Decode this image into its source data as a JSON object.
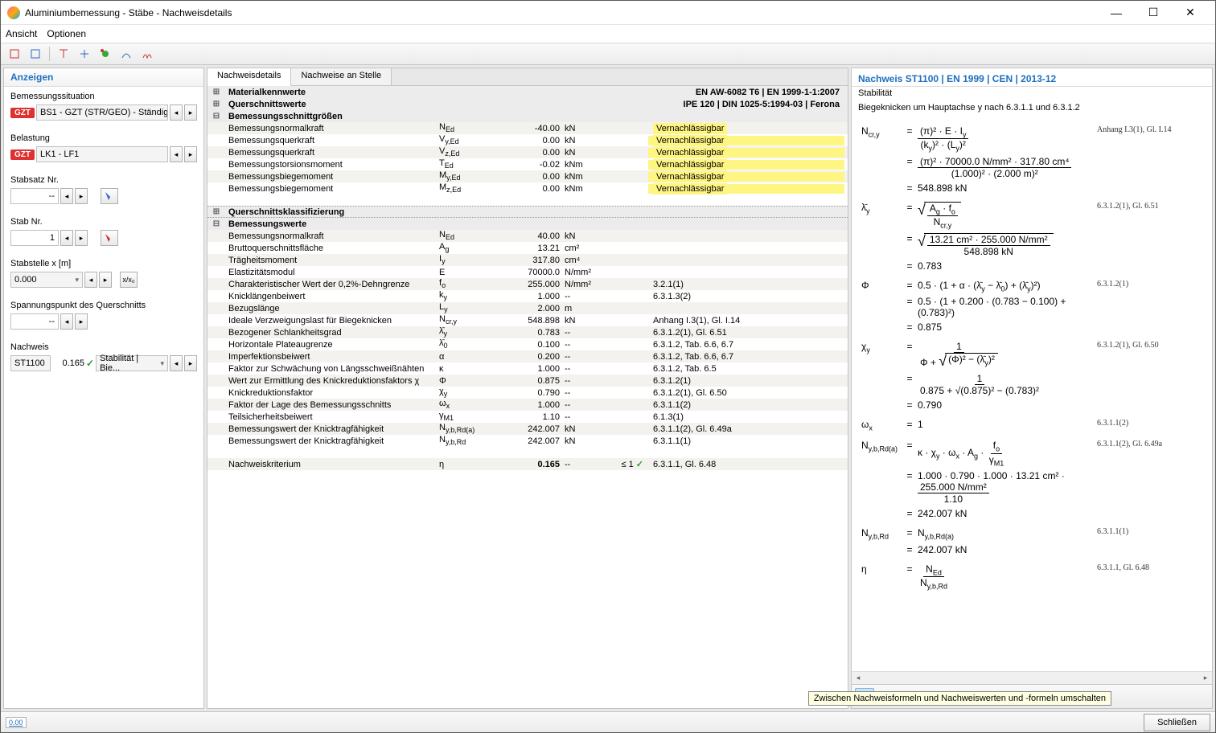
{
  "title": "Aluminiumbemessung - Stäbe - Nachweisdetails",
  "menu": {
    "m1": "Ansicht",
    "m2": "Optionen"
  },
  "left": {
    "header": "Anzeigen",
    "ds_label": "Bemessungssituation",
    "ds_badge": "GZT",
    "ds_value": "BS1 - GZT (STR/GEO) - Ständig ...",
    "load_label": "Belastung",
    "load_badge": "GZT",
    "load_value": "LK1 - LF1",
    "memberset_label": "Stabsatz Nr.",
    "memberset_value": "--",
    "member_label": "Stab Nr.",
    "member_value": "1",
    "x_label": "Stabstelle x [m]",
    "x_value": "0.000",
    "stress_label": "Spannungspunkt des Querschnitts",
    "stress_value": "--",
    "check_label": "Nachweis",
    "check_id": "ST1100",
    "check_ratio": "0.165",
    "check_name": "Stabilität | Bie..."
  },
  "tabs": {
    "t1": "Nachweisdetails",
    "t2": "Nachweise an Stelle"
  },
  "sections": {
    "s1": "Materialkennwerte",
    "s1r": "EN AW-6082 T6 | EN 1999-1-1:2007",
    "s2": "Querschnittswerte",
    "s2r": "IPE 120 | DIN 1025-5:1994-03 | Ferona",
    "s3": "Bemessungsschnittgrößen",
    "s4": "Querschnittsklassifizierung",
    "s5": "Bemessungswerte"
  },
  "rows": [
    {
      "l": "Bemessungsnormalkraft",
      "s": "N",
      "sub": "Ed",
      "v": "-40.00",
      "u": "kN",
      "r": "",
      "neg": "Vernachlässigbar",
      "hl": false
    },
    {
      "l": "Bemessungsquerkraft",
      "s": "V",
      "sub": "y,Ed",
      "v": "0.00",
      "u": "kN",
      "r": "",
      "neg": "Vernachlässigbar",
      "hl": true
    },
    {
      "l": "Bemessungsquerkraft",
      "s": "V",
      "sub": "z,Ed",
      "v": "0.00",
      "u": "kN",
      "r": "",
      "neg": "Vernachlässigbar",
      "hl": true
    },
    {
      "l": "Bemessungstorsionsmoment",
      "s": "T",
      "sub": "Ed",
      "v": "-0.02",
      "u": "kNm",
      "r": "",
      "neg": "Vernachlässigbar",
      "hl": true
    },
    {
      "l": "Bemessungsbiegemoment",
      "s": "M",
      "sub": "y,Ed",
      "v": "0.00",
      "u": "kNm",
      "r": "",
      "neg": "Vernachlässigbar",
      "hl": true
    },
    {
      "l": "Bemessungsbiegemoment",
      "s": "M",
      "sub": "z,Ed",
      "v": "0.00",
      "u": "kNm",
      "r": "",
      "neg": "Vernachlässigbar",
      "hl": true
    }
  ],
  "rows2": [
    {
      "l": "Bemessungsnormalkraft",
      "s": "N",
      "sub": "Ed",
      "v": "40.00",
      "u": "kN",
      "r": ""
    },
    {
      "l": "Bruttoquerschnittsfläche",
      "s": "A",
      "sub": "g",
      "v": "13.21",
      "u": "cm²",
      "r": ""
    },
    {
      "l": "Trägheitsmoment",
      "s": "I",
      "sub": "y",
      "v": "317.80",
      "u": "cm⁴",
      "r": ""
    },
    {
      "l": "Elastizitätsmodul",
      "s": "E",
      "sub": "",
      "v": "70000.0",
      "u": "N/mm²",
      "r": ""
    },
    {
      "l": "Charakteristischer Wert der 0,2%-Dehngrenze",
      "s": "f",
      "sub": "o",
      "v": "255.000",
      "u": "N/mm²",
      "r": "3.2.1(1)"
    },
    {
      "l": "Knicklängenbeiwert",
      "s": "k",
      "sub": "y",
      "v": "1.000",
      "u": "--",
      "r": "6.3.1.3(2)"
    },
    {
      "l": "Bezugslänge",
      "s": "L",
      "sub": "y",
      "v": "2.000",
      "u": "m",
      "r": ""
    },
    {
      "l": "Ideale Verzweigungslast für Biegeknicken",
      "s": "N",
      "sub": "cr,y",
      "v": "548.898",
      "u": "kN",
      "r": "Anhang I.3(1), Gl. I.14"
    },
    {
      "l": "Bezogener Schlankheitsgrad",
      "s": "λ̄",
      "sub": "y",
      "v": "0.783",
      "u": "--",
      "r": "6.3.1.2(1), Gl. 6.51"
    },
    {
      "l": "Horizontale Plateaugrenze",
      "s": "λ̄",
      "sub": "0",
      "v": "0.100",
      "u": "--",
      "r": "6.3.1.2, Tab. 6.6, 6.7"
    },
    {
      "l": "Imperfektionsbeiwert",
      "s": "α",
      "sub": "",
      "v": "0.200",
      "u": "--",
      "r": "6.3.1.2, Tab. 6.6, 6.7"
    },
    {
      "l": "Faktor zur Schwächung von Längsschweißnähten",
      "s": "κ",
      "sub": "",
      "v": "1.000",
      "u": "--",
      "r": "6.3.1.2, Tab. 6.5"
    },
    {
      "l": "Wert zur Ermittlung des Knickreduktionsfaktors χ",
      "s": "Φ",
      "sub": "",
      "v": "0.875",
      "u": "--",
      "r": "6.3.1.2(1)"
    },
    {
      "l": "Knickreduktionsfaktor",
      "s": "χ",
      "sub": "y",
      "v": "0.790",
      "u": "--",
      "r": "6.3.1.2(1), Gl. 6.50"
    },
    {
      "l": "Faktor der Lage des Bemessungsschnitts",
      "s": "ω",
      "sub": "x",
      "v": "1.000",
      "u": "--",
      "r": "6.3.1.1(2)"
    },
    {
      "l": "Teilsicherheitsbeiwert",
      "s": "γ",
      "sub": "M1",
      "v": "1.10",
      "u": "--",
      "r": "6.1.3(1)"
    },
    {
      "l": "Bemessungswert der Knicktragfähigkeit",
      "s": "N",
      "sub": "y,b,Rd(a)",
      "v": "242.007",
      "u": "kN",
      "r": "6.3.1.1(2), Gl. 6.49a"
    },
    {
      "l": "Bemessungswert der Knicktragfähigkeit",
      "s": "N",
      "sub": "y,b,Rd",
      "v": "242.007",
      "u": "kN",
      "r": "6.3.1.1(1)"
    }
  ],
  "crit": {
    "l": "Nachweiskriterium",
    "s": "η",
    "v": "0.165",
    "u": "--",
    "lim": "≤ 1",
    "r": "6.3.1.1, Gl. 6.48"
  },
  "right": {
    "hdr": "Nachweis ST1100 | EN 1999 | CEN | 2013-12",
    "sub1": "Stabilität",
    "sub2": "Biegeknicken um Hauptachse y nach 6.3.1.1 und 6.3.1.2",
    "refs": {
      "r1": "Anhang I.3(1), Gl. I.14",
      "r2": "6.3.1.2(1), Gl. 6.51",
      "r3": "6.3.1.2(1)",
      "r4": "6.3.1.2(1), Gl. 6.50",
      "r5": "6.3.1.1(2)",
      "r6": "6.3.1.1(2), Gl. 6.49a",
      "r7": "6.3.1.1(1)",
      "r8": "6.3.1.1, Gl. 6.48"
    },
    "vals": {
      "ncry_num": "(π)² · 70000.0 N/mm² · 317.80 cm⁴",
      "ncry_den": "(1.000)² · (2.000 m)²",
      "ncry": "548.898 kN",
      "lam_num": "13.21 cm² · 255.000 N/mm²",
      "lam_den": "548.898 kN",
      "lam": "0.783",
      "phi_expr": "0.5 · (1 + 0.200 · (0.783 − 0.100) + (0.783)²)",
      "phi": "0.875",
      "chi_den": "0.875 + √(0.875)² − (0.783)²",
      "chi": "0.790",
      "ox": "1",
      "nybrd_expr": "1.000 · 0.790 · 1.000 · 13.21 cm² ·",
      "nybrd_frac_num": "255.000 N/mm²",
      "nybrd_frac_den": "1.10",
      "nybrd": "242.007 kN",
      "nybrd2": "242.007 kN"
    }
  },
  "tooltip": "Zwischen Nachweisformeln und Nachweiswerten und -formeln umschalten",
  "close": "Schließen",
  "sb": "0.00"
}
